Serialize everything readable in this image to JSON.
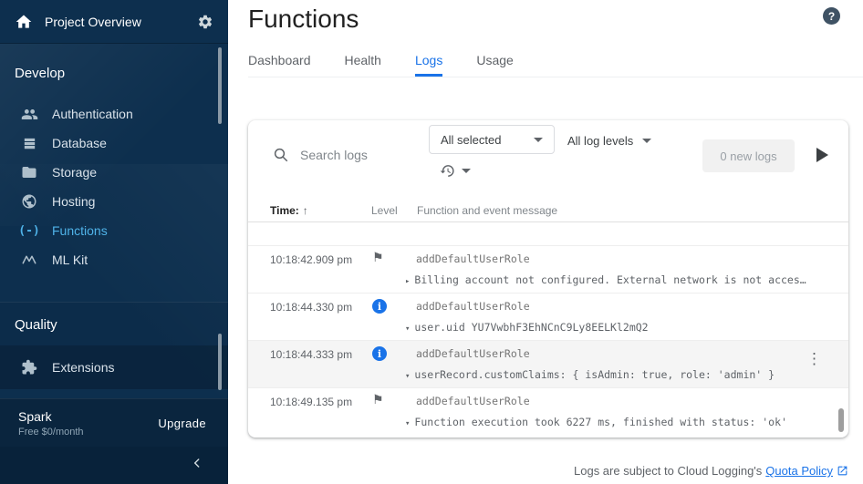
{
  "colors": {
    "accent_blue": "#1a73e8",
    "sidebar_bg": "#0d2f4e",
    "sidebar_active": "#4fb3e9",
    "info_icon": "#1a73e8",
    "link": "#1a73e8"
  },
  "icons": {
    "help": "?",
    "flag": "⚑",
    "info_letter": "i",
    "kebab": "⋮",
    "sort_up": "↑",
    "functions_glyph": "(-)"
  },
  "sidebar": {
    "project_label": "Project Overview",
    "sections": [
      {
        "header": "Develop",
        "items": [
          {
            "label": "Authentication"
          },
          {
            "label": "Database"
          },
          {
            "label": "Storage"
          },
          {
            "label": "Hosting"
          },
          {
            "label": "Functions"
          },
          {
            "label": "ML Kit"
          }
        ]
      },
      {
        "header": "Quality",
        "items": [
          {
            "label": "Extensions"
          }
        ]
      }
    ],
    "plan": {
      "name": "Spark",
      "detail": "Free $0/month",
      "upgrade_label": "Upgrade"
    }
  },
  "header": {
    "title": "Functions"
  },
  "tabs": [
    {
      "label": "Dashboard"
    },
    {
      "label": "Health"
    },
    {
      "label": "Logs",
      "active": true
    },
    {
      "label": "Usage"
    }
  ],
  "toolbar": {
    "search_placeholder": "Search logs",
    "selected_dropdown": "All selected",
    "levels_dropdown": "All log levels",
    "new_logs_label": "0 new logs"
  },
  "table": {
    "columns": {
      "time": "Time:",
      "level": "Level",
      "message": "Function and event message"
    },
    "rows": [
      {
        "time": "10:18:42.909 pm",
        "level": "flag",
        "function": "addDefaultUserRole",
        "expander": "▸",
        "message": "Billing account not configured. External network is not acces…"
      },
      {
        "time": "10:18:44.330 pm",
        "level": "info",
        "function": "addDefaultUserRole",
        "expander": "▾",
        "message": "user.uid YU7VwbhF3EhNCnC9Ly8EELKl2mQ2"
      },
      {
        "time": "10:18:44.333 pm",
        "level": "info",
        "function": "addDefaultUserRole",
        "expander": "▾",
        "message": "userRecord.customClaims: { isAdmin: true, role: 'admin' }",
        "highlighted": true
      },
      {
        "time": "10:18:49.135 pm",
        "level": "flag",
        "function": "addDefaultUserRole",
        "expander": "▾",
        "message": "Function execution took 6227 ms, finished with status: 'ok'"
      }
    ]
  },
  "footer": {
    "prefix": "Logs are subject to Cloud Logging's",
    "link": "Quota Policy"
  }
}
